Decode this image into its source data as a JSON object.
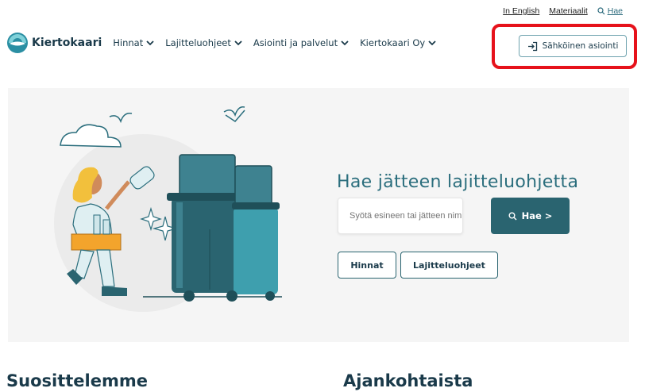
{
  "utility": {
    "english": "In English",
    "materials": "Materiaalit",
    "search": "Hae"
  },
  "brand": {
    "name": "Kiertokaari"
  },
  "nav": [
    {
      "label": "Hinnat"
    },
    {
      "label": "Lajitteluohjeet"
    },
    {
      "label": "Asiointi ja palvelut"
    },
    {
      "label": "Kiertokaari Oy"
    }
  ],
  "cta": {
    "label": "Sähköinen asiointi"
  },
  "hero": {
    "title": "Hae jätteen lajitteluohjetta",
    "search_placeholder": "Syötä esineen tai jätteen nimi",
    "search_button": "Hae >",
    "quick_links": [
      "Hinnat",
      "Lajitteluohjeet"
    ]
  },
  "sections": {
    "recommend": "Suosittelemme",
    "current": "Ajankohtaista"
  },
  "colors": {
    "brand": "#2b6e7d",
    "button": "#2a6470",
    "highlight": "#e6121b"
  }
}
